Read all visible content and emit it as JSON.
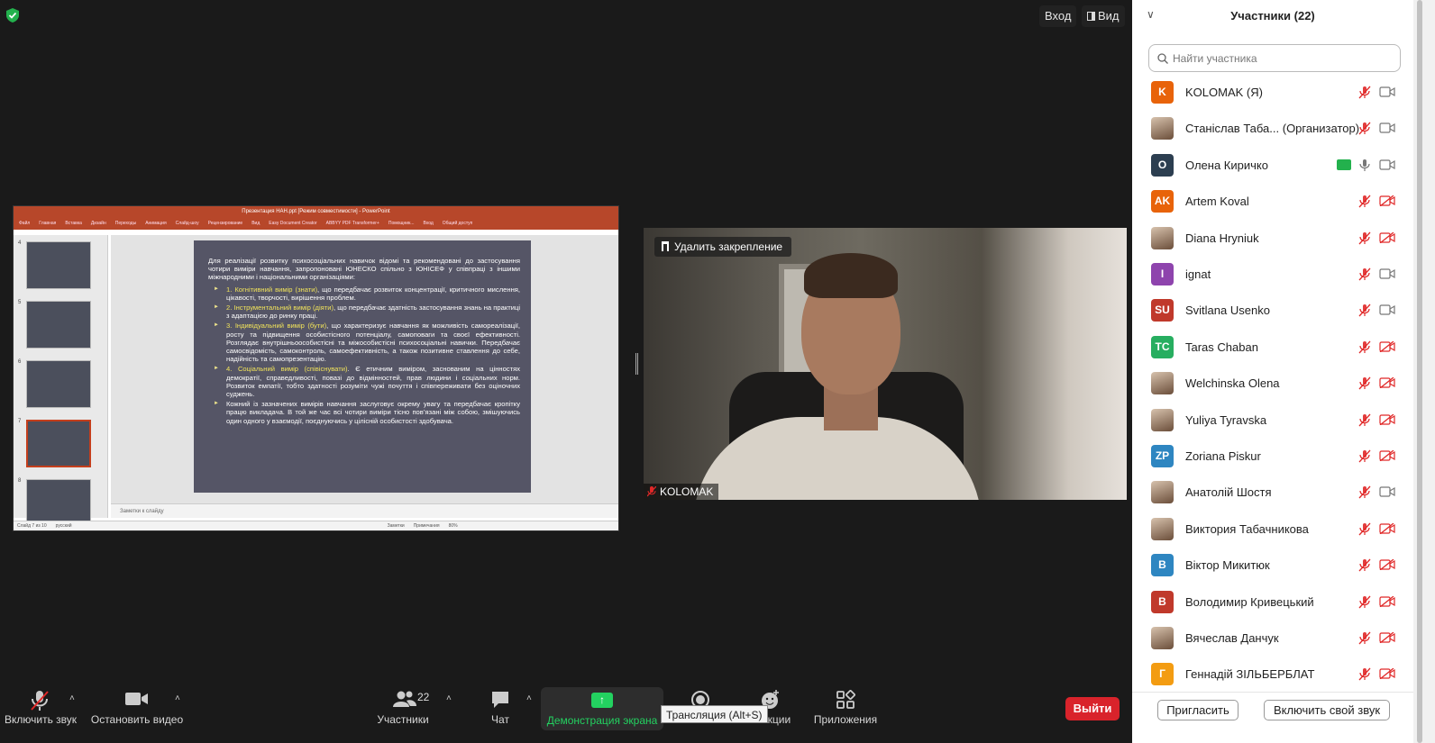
{
  "colors": {
    "accent_green": "#23d160",
    "leave_red": "#d9232b",
    "ppt_red": "#b7472a"
  },
  "topbar": {
    "enter_label": "Вход",
    "view_label": "Вид"
  },
  "share": {
    "ppt_title": "Презентация НАН.ppt [Режим совместимости] - PowerPoint",
    "ribbon_tabs": [
      "Файл",
      "Главная",
      "Вставка",
      "Дизайн",
      "Переходы",
      "Анимация",
      "Слайд-шоу",
      "Рецензирование",
      "Вид",
      "Easy Document Creator",
      "ABBYY PDF Transformer+",
      "Помощник...",
      "Вход",
      "Общий доступ"
    ],
    "thumb_numbers": [
      "4",
      "5",
      "6",
      "7",
      "8"
    ],
    "slide": {
      "lead": "Для реалізації розвитку психосоціальних навичок відомі та рекомендовані до застосування чотири виміри навчання, запропоновані ЮНЕСКО спільно з ЮНІСЕФ у співпраці з іншими міжнародними і національними організаціями:",
      "items": [
        {
          "hl": "1. Когнітивний вимір (знати)",
          "text": ", що передбачає розвиток концентрації, критичного мислення, цікавості, творчості, вирішення проблем."
        },
        {
          "hl": "2. Інструментальний вимір (діяти)",
          "text": ", що передбачає здатність застосування знань на практиці з адаптацією до ринку праці."
        },
        {
          "hl": "3. Індивідуальний вимір (бути)",
          "text": ", що характеризує навчання як можливість самореалізації, росту та підвищення особистісного потенціалу, самоповаги та своєї ефективності. Розглядає внутрішньоособистісні та міжособистісні психосоціальні навички. Передбачає самосвідомість, самоконтроль, самоефективність, а також позитивне ставлення до себе, надійність та самопрезентацію."
        },
        {
          "hl": "4. Соціальний вимір (співіснувати)",
          "text": ". Є етичним виміром, заснованим на цінностях демократії, справедливості, повазі до відмінностей, прав людини і соціальних норм. Розвиток емпатії, тобто здатності розуміти чужі почуття і співпереживати без оціночних суджень."
        },
        {
          "hl": "",
          "text": "Кожний із зазначених вимірів навчання заслуговує окрему увагу та передбачає кропітку працю викладача. В той же час всі чотири виміри тісно пов’язані між собою, змішуючись один одного у взаємодії, поєднуючись у цілісній особистості здобувача."
        }
      ]
    },
    "notes_label": "Заметки к слайду",
    "status": [
      "Слайд 7 из 10",
      "русский",
      "Заметки",
      "Примечания",
      "80%"
    ]
  },
  "video": {
    "unpin_label": "Удалить закрепление",
    "name": "KOLOMAK"
  },
  "toolbar": {
    "unmute": "Включить звук",
    "stop_video": "Остановить видео",
    "participants": "Участники",
    "participants_count": "22",
    "chat": "Чат",
    "share_screen": "Демонстрация экрана",
    "tooltip": "Трансляция (Alt+S)",
    "reactions": "Реакции",
    "apps": "Приложения",
    "leave": "Выйти"
  },
  "panel": {
    "title": "Участники (22)",
    "search_placeholder": "Найти участника",
    "invite": "Пригласить",
    "unmute_self": "Включить свой звук",
    "participants": [
      {
        "name": "KOLOMAK (Я)",
        "initials": "K",
        "color": "#e8630a",
        "photo": false,
        "mic": "muted",
        "cam": "on"
      },
      {
        "name": "Станіслав Таба...  (Организатор)",
        "initials": "",
        "color": "",
        "photo": true,
        "mic": "muted",
        "cam": "on"
      },
      {
        "name": "Олена Киричко",
        "initials": "O",
        "color": "#2c3e50",
        "photo": false,
        "mic": "on",
        "cam": "on",
        "sharing": true
      },
      {
        "name": "Artem Koval",
        "initials": "AK",
        "color": "#e8630a",
        "photo": false,
        "mic": "muted",
        "cam": "off"
      },
      {
        "name": "Diana Hryniuk",
        "initials": "",
        "color": "",
        "photo": true,
        "mic": "muted",
        "cam": "off"
      },
      {
        "name": "ignat",
        "initials": "I",
        "color": "#8e44ad",
        "photo": false,
        "mic": "muted",
        "cam": "on"
      },
      {
        "name": "Svitlana Usenko",
        "initials": "SU",
        "color": "#c0392b",
        "photo": false,
        "mic": "muted",
        "cam": "on"
      },
      {
        "name": "Taras Chaban",
        "initials": "TC",
        "color": "#27ae60",
        "photo": false,
        "mic": "muted",
        "cam": "off"
      },
      {
        "name": "Welchinska Olena",
        "initials": "",
        "color": "",
        "photo": true,
        "mic": "muted",
        "cam": "off"
      },
      {
        "name": "Yuliya Tyravska",
        "initials": "",
        "color": "",
        "photo": true,
        "mic": "muted",
        "cam": "off"
      },
      {
        "name": "Zoriana Piskur",
        "initials": "ZP",
        "color": "#2e86c1",
        "photo": false,
        "mic": "muted",
        "cam": "off"
      },
      {
        "name": "Анатолій Шостя",
        "initials": "",
        "color": "",
        "photo": true,
        "mic": "muted",
        "cam": "on"
      },
      {
        "name": "Виктория Табачникова",
        "initials": "",
        "color": "",
        "photo": true,
        "mic": "muted",
        "cam": "off"
      },
      {
        "name": "Віктор Микитюк",
        "initials": "В",
        "color": "#2e86c1",
        "photo": false,
        "mic": "muted",
        "cam": "off"
      },
      {
        "name": "Володимир Кривецький",
        "initials": "В",
        "color": "#c0392b",
        "photo": false,
        "mic": "muted",
        "cam": "off"
      },
      {
        "name": "Вячеслав Данчук",
        "initials": "",
        "color": "",
        "photo": true,
        "mic": "muted",
        "cam": "off"
      },
      {
        "name": "Геннадій ЗІЛЬБЕРБЛАТ",
        "initials": "Г",
        "color": "#f39c12",
        "photo": false,
        "mic": "muted",
        "cam": "off"
      }
    ]
  }
}
